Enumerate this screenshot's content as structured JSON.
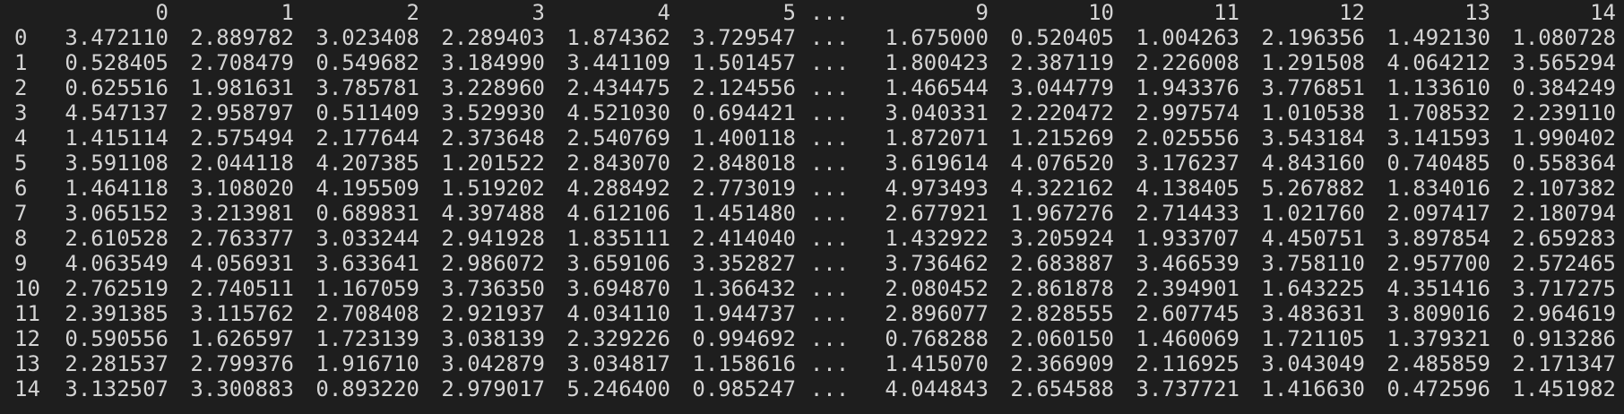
{
  "dataframe": {
    "columns": [
      "0",
      "1",
      "2",
      "3",
      "4",
      "5",
      "...",
      "9",
      "10",
      "11",
      "12",
      "13",
      "14"
    ],
    "rows": [
      {
        "index": "0",
        "values": [
          "3.472110",
          "2.889782",
          "3.023408",
          "2.289403",
          "1.874362",
          "3.729547",
          "...",
          "1.675000",
          "0.520405",
          "1.004263",
          "2.196356",
          "1.492130",
          "1.080728"
        ]
      },
      {
        "index": "1",
        "values": [
          "0.528405",
          "2.708479",
          "0.549682",
          "3.184990",
          "3.441109",
          "1.501457",
          "...",
          "1.800423",
          "2.387119",
          "2.226008",
          "1.291508",
          "4.064212",
          "3.565294"
        ]
      },
      {
        "index": "2",
        "values": [
          "0.625516",
          "1.981631",
          "3.785781",
          "3.228960",
          "2.434475",
          "2.124556",
          "...",
          "1.466544",
          "3.044779",
          "1.943376",
          "3.776851",
          "1.133610",
          "0.384249"
        ]
      },
      {
        "index": "3",
        "values": [
          "4.547137",
          "2.958797",
          "0.511409",
          "3.529930",
          "4.521030",
          "0.694421",
          "...",
          "3.040331",
          "2.220472",
          "2.997574",
          "1.010538",
          "1.708532",
          "2.239110"
        ]
      },
      {
        "index": "4",
        "values": [
          "1.415114",
          "2.575494",
          "2.177644",
          "2.373648",
          "2.540769",
          "1.400118",
          "...",
          "1.872071",
          "1.215269",
          "2.025556",
          "3.543184",
          "3.141593",
          "1.990402"
        ]
      },
      {
        "index": "5",
        "values": [
          "3.591108",
          "2.044118",
          "4.207385",
          "1.201522",
          "2.843070",
          "2.848018",
          "...",
          "3.619614",
          "4.076520",
          "3.176237",
          "4.843160",
          "0.740485",
          "0.558364"
        ]
      },
      {
        "index": "6",
        "values": [
          "1.464118",
          "3.108020",
          "4.195509",
          "1.519202",
          "4.288492",
          "2.773019",
          "...",
          "4.973493",
          "4.322162",
          "4.138405",
          "5.267882",
          "1.834016",
          "2.107382"
        ]
      },
      {
        "index": "7",
        "values": [
          "3.065152",
          "3.213981",
          "0.689831",
          "4.397488",
          "4.612106",
          "1.451480",
          "...",
          "2.677921",
          "1.967276",
          "2.714433",
          "1.021760",
          "2.097417",
          "2.180794"
        ]
      },
      {
        "index": "8",
        "values": [
          "2.610528",
          "2.763377",
          "3.033244",
          "2.941928",
          "1.835111",
          "2.414040",
          "...",
          "1.432922",
          "3.205924",
          "1.933707",
          "4.450751",
          "3.897854",
          "2.659283"
        ]
      },
      {
        "index": "9",
        "values": [
          "4.063549",
          "4.056931",
          "3.633641",
          "2.986072",
          "3.659106",
          "3.352827",
          "...",
          "3.736462",
          "2.683887",
          "3.466539",
          "3.758110",
          "2.957700",
          "2.572465"
        ]
      },
      {
        "index": "10",
        "values": [
          "2.762519",
          "2.740511",
          "1.167059",
          "3.736350",
          "3.694870",
          "1.366432",
          "...",
          "2.080452",
          "2.861878",
          "2.394901",
          "1.643225",
          "4.351416",
          "3.717275"
        ]
      },
      {
        "index": "11",
        "values": [
          "2.391385",
          "3.115762",
          "2.708408",
          "2.921937",
          "4.034110",
          "1.944737",
          "...",
          "2.896077",
          "2.828555",
          "2.607745",
          "3.483631",
          "3.809016",
          "2.964619"
        ]
      },
      {
        "index": "12",
        "values": [
          "0.590556",
          "1.626597",
          "1.723139",
          "3.038139",
          "2.329226",
          "0.994692",
          "...",
          "0.768288",
          "2.060150",
          "1.460069",
          "1.721105",
          "1.379321",
          "0.913286"
        ]
      },
      {
        "index": "13",
        "values": [
          "2.281537",
          "2.799376",
          "1.916710",
          "3.042879",
          "3.034817",
          "1.158616",
          "...",
          "1.415070",
          "2.366909",
          "2.116925",
          "3.043049",
          "2.485859",
          "2.171347"
        ]
      },
      {
        "index": "14",
        "values": [
          "3.132507",
          "3.300883",
          "0.893220",
          "2.979017",
          "5.246400",
          "0.985247",
          "...",
          "4.044843",
          "2.654588",
          "3.737721",
          "1.416630",
          "0.472596",
          "1.451982"
        ]
      }
    ]
  },
  "theme": {
    "background": "#1e1e1e",
    "text": "#d4d4d4"
  }
}
